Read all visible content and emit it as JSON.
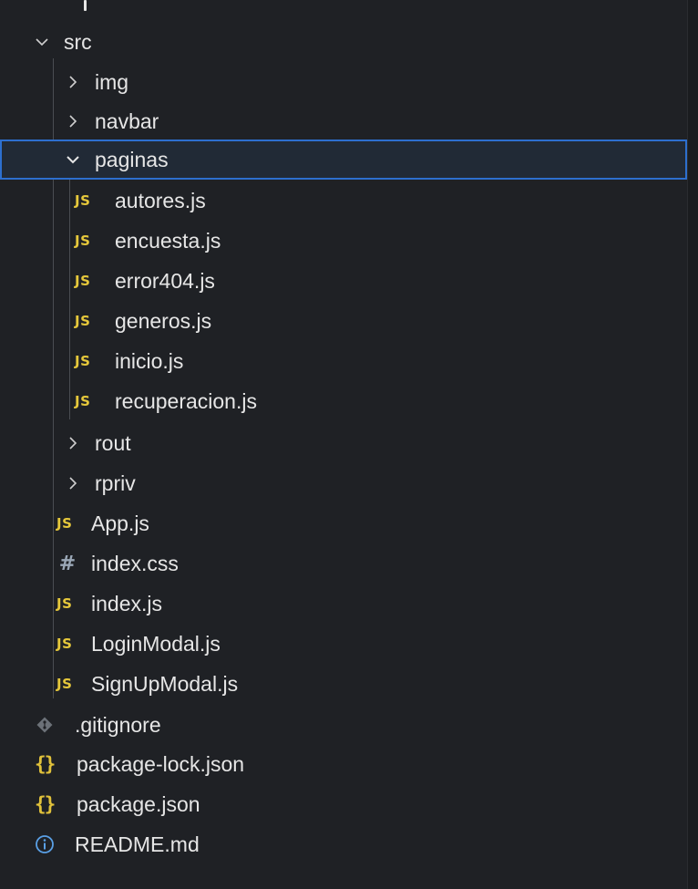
{
  "explorer": {
    "src_folder": {
      "label": "src",
      "expanded": true
    },
    "img_folder": {
      "label": "img",
      "expanded": false
    },
    "navbar_folder": {
      "label": "navbar",
      "expanded": false
    },
    "paginas_folder": {
      "label": "paginas",
      "expanded": true,
      "selected": true
    },
    "paginas_files": [
      {
        "label": "autores.js",
        "icon": "js-icon"
      },
      {
        "label": "encuesta.js",
        "icon": "js-icon"
      },
      {
        "label": "error404.js",
        "icon": "js-icon"
      },
      {
        "label": "generos.js",
        "icon": "js-icon"
      },
      {
        "label": "inicio.js",
        "icon": "js-icon"
      },
      {
        "label": "recuperacion.js",
        "icon": "js-icon"
      }
    ],
    "rout_folder": {
      "label": "rout",
      "expanded": false
    },
    "rpriv_folder": {
      "label": "rpriv",
      "expanded": false
    },
    "src_files": [
      {
        "label": "App.js",
        "icon": "js-icon"
      },
      {
        "label": "index.css",
        "icon": "hash-icon"
      },
      {
        "label": "index.js",
        "icon": "js-icon"
      },
      {
        "label": "LoginModal.js",
        "icon": "js-icon"
      },
      {
        "label": "SignUpModal.js",
        "icon": "js-icon"
      }
    ],
    "root_files": [
      {
        "label": ".gitignore",
        "icon": "git-icon"
      },
      {
        "label": "package-lock.json",
        "icon": "json-braces-icon"
      },
      {
        "label": "package.json",
        "icon": "json-braces-icon"
      },
      {
        "label": "README.md",
        "icon": "info-icon"
      }
    ],
    "icons": {
      "js_text": "JS",
      "hash_text": "#",
      "json_text": "{}"
    },
    "colors": {
      "background": "#1f2125",
      "selection_border": "#2d6fce",
      "js_icon": "#e6c83b",
      "json_icon": "#e0c13a",
      "css_icon": "#9aa7b6",
      "info_icon": "#5aa0e6"
    }
  }
}
